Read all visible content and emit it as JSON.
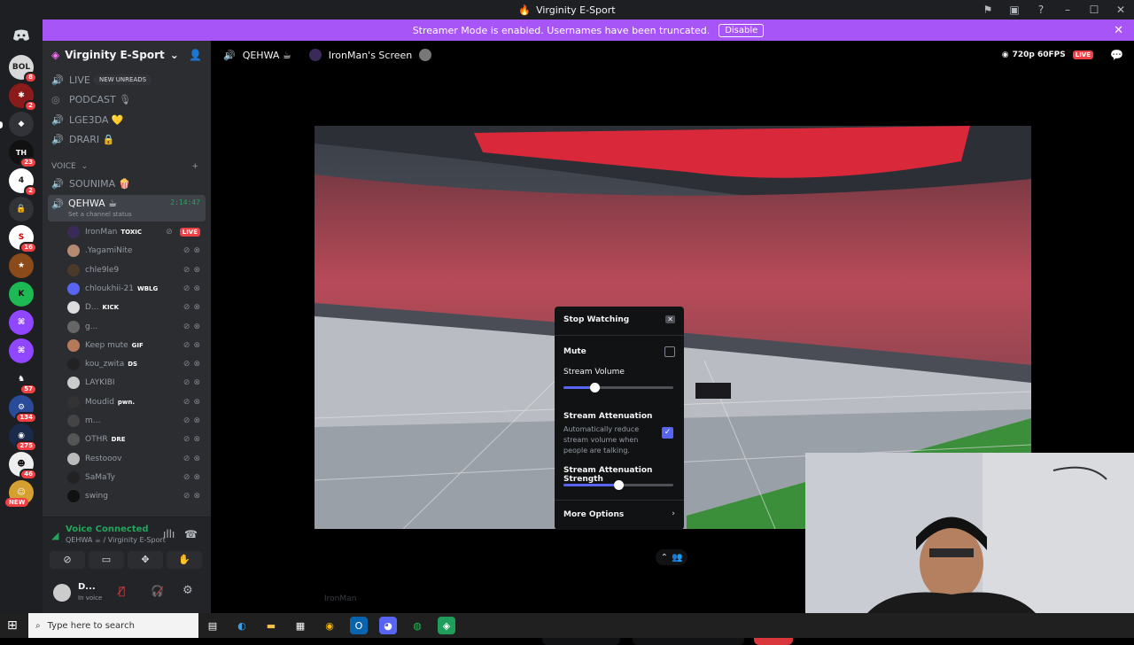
{
  "window": {
    "title": "Virginity E-Sport",
    "icon": "discord-logo"
  },
  "banner": {
    "text": "Streamer Mode is enabled. Usernames have been truncated.",
    "button": "Disable"
  },
  "guilds": {
    "badges": [
      "8",
      "2",
      "23",
      "2",
      "16",
      "57",
      "134",
      "275",
      "46"
    ],
    "new_label": "NEW"
  },
  "server": {
    "name": "Virginity E-Sport"
  },
  "channels": {
    "live": "LIVE C",
    "new_unreads": "NEW UNREADS",
    "podcast": "PODCAST 🎙",
    "lge3da": "LGE3DA 💛",
    "drari": "DRARI 🔒",
    "voice_category": "VOICE",
    "sounima": "SOUNIMA 🍿",
    "qehwa": "QEHWA ☕",
    "qehwa_time": "2:14:47",
    "qehwa_status": "Set a channel status"
  },
  "users": [
    {
      "name": "IronMan",
      "tag": "TOXIC",
      "live": "LIVE"
    },
    {
      "name": ".YagamiNite",
      "tag": ""
    },
    {
      "name": "chle9le9",
      "tag": ""
    },
    {
      "name": "chloukhii-21",
      "tag": "WBLG"
    },
    {
      "name": "D...",
      "tag": "KICK"
    },
    {
      "name": "g...",
      "tag": ""
    },
    {
      "name": "Keep mute",
      "tag": "GIF"
    },
    {
      "name": "kou_zwita",
      "tag": "DS"
    },
    {
      "name": "LAYKIBI",
      "tag": ""
    },
    {
      "name": "Moudid",
      "tag": "pwn."
    },
    {
      "name": "m...",
      "tag": ""
    },
    {
      "name": "OTHR",
      "tag": "DRE"
    },
    {
      "name": "Restooov",
      "tag": ""
    },
    {
      "name": "SaMaTy",
      "tag": ""
    },
    {
      "name": "swing",
      "tag": ""
    }
  ],
  "voice": {
    "status": "Voice Connected",
    "location": "QEHWA ☕ / Virginity E-Sport"
  },
  "account": {
    "name": "D...",
    "status": "In voice"
  },
  "stage": {
    "channel": "QEHWA ☕",
    "screen": "IronMan's Screen",
    "quality": "720p 60FPS",
    "live": "LIVE",
    "streamer_label": "IronMan"
  },
  "popup": {
    "stop": "Stop Watching",
    "mute": "Mute",
    "volume_label": "Stream Volume",
    "volume_value": 0.28,
    "attenuation_label": "Stream Attenuation",
    "attenuation_desc": "Automatically reduce stream volume when people are talking.",
    "attenuation_checked": true,
    "strength_label": "Stream Attenuation Strength",
    "strength_value": 0.5,
    "more": "More Options"
  },
  "taskbar": {
    "search_placeholder": "Type here to search"
  },
  "colors": {
    "accent": "#5865f2",
    "banner": "#a855f7",
    "danger": "#ed4245"
  }
}
